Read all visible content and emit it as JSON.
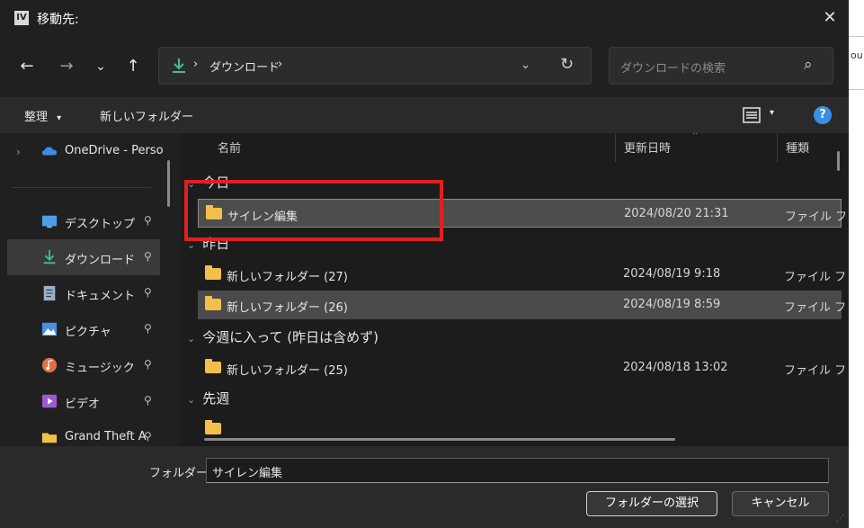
{
  "background": {
    "side_text": "ou"
  },
  "dialog": {
    "title": "移動先:",
    "app_icon_text": "IV",
    "close_glyph": "✕"
  },
  "nav": {
    "back": "←",
    "forward": "→",
    "recent": "⌄",
    "up": "↑",
    "address_sep": "›",
    "address_crumb": "ダウンロード",
    "address_trail_sep": "›",
    "address_chevron": "⌄",
    "refresh": "↻",
    "search_placeholder": "ダウンロードの検索",
    "search_icon": "⌕"
  },
  "toolbar": {
    "organize": "整理",
    "organize_caret": "▾",
    "new_folder": "新しいフォルダー",
    "view_caret": "▾",
    "help": "?"
  },
  "sidebar": {
    "expand_glyph": "›",
    "items": [
      {
        "label": "OneDrive - Perso",
        "icon": "cloud-icon",
        "color": "#3a8ee8",
        "pinned": false,
        "selected": false
      },
      {
        "label": "デスクトップ",
        "icon": "desktop-icon",
        "color": "#4aa0e8",
        "pinned": true,
        "selected": false
      },
      {
        "label": "ダウンロード",
        "icon": "download-icon",
        "color": "#3dbf9a",
        "pinned": true,
        "selected": true
      },
      {
        "label": "ドキュメント",
        "icon": "document-icon",
        "color": "#9ab0c8",
        "pinned": true,
        "selected": false
      },
      {
        "label": "ピクチャ",
        "icon": "picture-icon",
        "color": "#4a90e0",
        "pinned": true,
        "selected": false
      },
      {
        "label": "ミュージック",
        "icon": "music-icon",
        "color": "#e0704a",
        "pinned": true,
        "selected": false
      },
      {
        "label": "ビデオ",
        "icon": "video-icon",
        "color": "#9a5ad0",
        "pinned": true,
        "selected": false
      },
      {
        "label": "Grand Theft A",
        "icon": "folder-icon",
        "color": "#f2c04a",
        "pinned": true,
        "selected": false
      }
    ],
    "pin_glyph": "📌"
  },
  "columns": {
    "name": "名前",
    "date": "更新日時",
    "type": "種類",
    "sort_caret": "⌃"
  },
  "groups": [
    {
      "label": "今日",
      "chevron": "⌄"
    },
    {
      "label": "昨日",
      "chevron": "⌄"
    },
    {
      "label": "今週に入って (昨日は含めず)",
      "chevron": "⌄"
    },
    {
      "label": "先週",
      "chevron": "⌄"
    }
  ],
  "files": [
    {
      "name": "サイレン編集",
      "date": "2024/08/20 21:31",
      "type": "ファイル フ",
      "state": "selected"
    },
    {
      "name": "新しいフォルダー (27)",
      "date": "2024/08/19 9:18",
      "type": "ファイル フ",
      "state": "normal"
    },
    {
      "name": "新しいフォルダー (26)",
      "date": "2024/08/19 8:59",
      "type": "ファイル フ",
      "state": "highlighted"
    },
    {
      "name": "新しいフォルダー (25)",
      "date": "2024/08/18 13:02",
      "type": "ファイル フ",
      "state": "normal"
    }
  ],
  "footer": {
    "folder_label": "フォルダー:",
    "folder_value": "サイレン編集",
    "select_button": "フォルダーの選択",
    "cancel_button": "キャンセル",
    "grip_glyph": "⋰"
  },
  "annotation": {
    "color": "#e02020"
  }
}
